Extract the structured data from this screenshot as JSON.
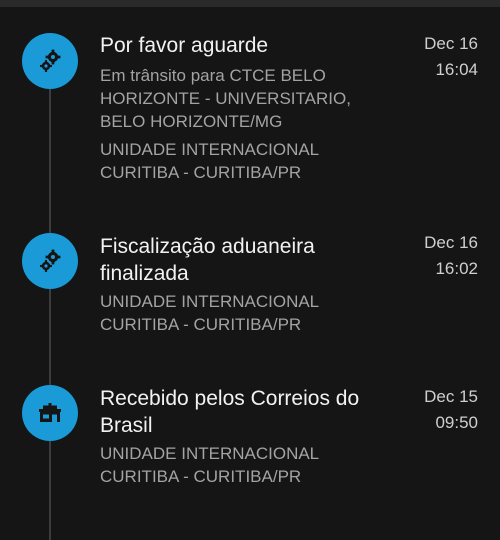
{
  "events": [
    {
      "icon": "gears-icon",
      "title": "Por favor aguarde",
      "detail_lines": [
        "Em trânsito para CTCE BELO",
        "HORIZONTE - UNIVERSITARIO,",
        "BELO HORIZONTE/MG"
      ],
      "location_lines": [
        "UNIDADE INTERNACIONAL",
        "CURITIBA - CURITIBA/PR"
      ],
      "date": "Dec 16",
      "time": "16:04"
    },
    {
      "icon": "gears-icon",
      "title_lines": [
        "Fiscalização aduaneira",
        "finalizada"
      ],
      "location_lines": [
        "UNIDADE INTERNACIONAL",
        "CURITIBA - CURITIBA/PR"
      ],
      "date": "Dec 16",
      "time": "16:02"
    },
    {
      "icon": "post-office-icon",
      "title_lines": [
        "Recebido pelos Correios do",
        "Brasil"
      ],
      "location_lines": [
        "UNIDADE INTERNACIONAL",
        "CURITIBA - CURITIBA/PR"
      ],
      "date": "Dec 15",
      "time": "09:50"
    }
  ],
  "colors": {
    "background": "#151515",
    "icon_circle": "#1a9bd8",
    "icon_glyph": "#151515",
    "title_text": "#f2f2f2",
    "secondary_text": "#a3a3a3",
    "timeline": "#3c3c3c"
  }
}
